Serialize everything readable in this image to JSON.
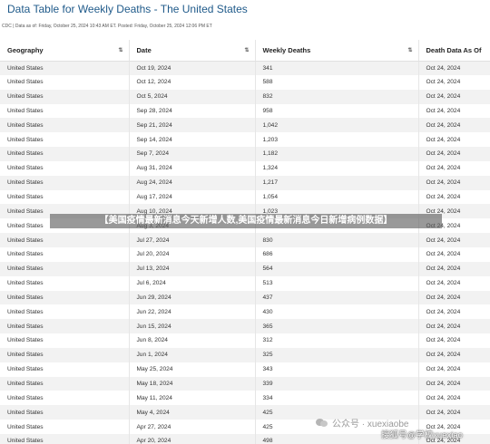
{
  "title": "Data Table for Weekly Deaths - The United States",
  "subtitle": "CDC | Data as of: Friday, October 25, 2024 10:43 AM ET. Posted: Friday, October 25, 2024 12:06 PM ET",
  "columns": [
    "Geography",
    "Date",
    "Weekly Deaths",
    "Death Data As Of"
  ],
  "sort_icon": "⇅",
  "rows": [
    [
      "United States",
      "Oct 19, 2024",
      "341",
      "Oct 24, 2024"
    ],
    [
      "United States",
      "Oct 12, 2024",
      "588",
      "Oct 24, 2024"
    ],
    [
      "United States",
      "Oct 5, 2024",
      "832",
      "Oct 24, 2024"
    ],
    [
      "United States",
      "Sep 28, 2024",
      "958",
      "Oct 24, 2024"
    ],
    [
      "United States",
      "Sep 21, 2024",
      "1,042",
      "Oct 24, 2024"
    ],
    [
      "United States",
      "Sep 14, 2024",
      "1,203",
      "Oct 24, 2024"
    ],
    [
      "United States",
      "Sep 7, 2024",
      "1,182",
      "Oct 24, 2024"
    ],
    [
      "United States",
      "Aug 31, 2024",
      "1,324",
      "Oct 24, 2024"
    ],
    [
      "United States",
      "Aug 24, 2024",
      "1,217",
      "Oct 24, 2024"
    ],
    [
      "United States",
      "Aug 17, 2024",
      "1,054",
      "Oct 24, 2024"
    ],
    [
      "United States",
      "Aug 10, 2024",
      "1,023",
      "Oct 24, 2024"
    ],
    [
      "United States",
      "Aug 3, 2024",
      "",
      "Oct 24, 2024"
    ],
    [
      "United States",
      "Jul 27, 2024",
      "830",
      "Oct 24, 2024"
    ],
    [
      "United States",
      "Jul 20, 2024",
      "686",
      "Oct 24, 2024"
    ],
    [
      "United States",
      "Jul 13, 2024",
      "564",
      "Oct 24, 2024"
    ],
    [
      "United States",
      "Jul 6, 2024",
      "513",
      "Oct 24, 2024"
    ],
    [
      "United States",
      "Jun 29, 2024",
      "437",
      "Oct 24, 2024"
    ],
    [
      "United States",
      "Jun 22, 2024",
      "430",
      "Oct 24, 2024"
    ],
    [
      "United States",
      "Jun 15, 2024",
      "365",
      "Oct 24, 2024"
    ],
    [
      "United States",
      "Jun 8, 2024",
      "312",
      "Oct 24, 2024"
    ],
    [
      "United States",
      "Jun 1, 2024",
      "325",
      "Oct 24, 2024"
    ],
    [
      "United States",
      "May 25, 2024",
      "343",
      "Oct 24, 2024"
    ],
    [
      "United States",
      "May 18, 2024",
      "339",
      "Oct 24, 2024"
    ],
    [
      "United States",
      "May 11, 2024",
      "334",
      "Oct 24, 2024"
    ],
    [
      "United States",
      "May 4, 2024",
      "425",
      "Oct 24, 2024"
    ],
    [
      "United States",
      "Apr 27, 2024",
      "425",
      "Oct 24, 2024"
    ],
    [
      "United States",
      "Apr 20, 2024",
      "498",
      "Oct 24, 2024"
    ]
  ],
  "banner": "【美国疫情最新消息今天新增人数,美国疫情最新消息今日新增病例数据】",
  "watermark_wechat": "公众号 · xuexiaobe",
  "watermark_sohu": "搜狐号@学校xuexiao"
}
